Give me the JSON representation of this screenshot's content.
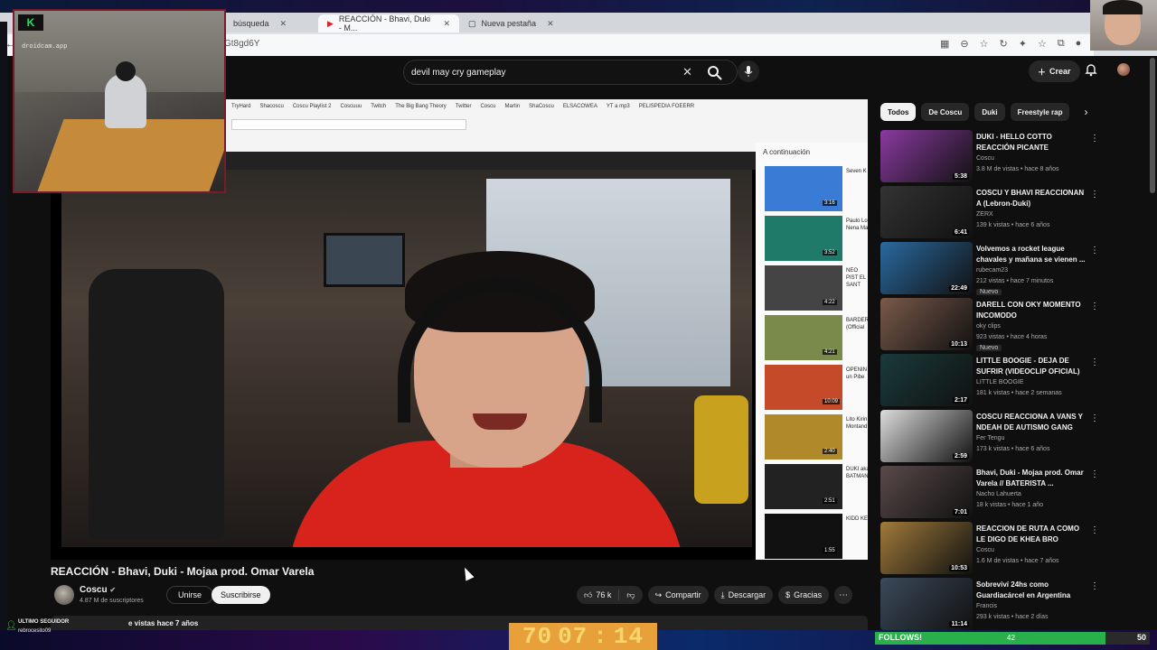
{
  "browser": {
    "tabs": [
      {
        "label": "búsqueda",
        "active": false
      },
      {
        "label": "REACCIÓN - Bhavi, Duki - M...",
        "active": true
      },
      {
        "label": "Nueva pestaña",
        "active": false
      }
    ],
    "url": "Gt8gd6Y"
  },
  "header": {
    "search_value": "devil may cry gameplay",
    "create_label": "Crear"
  },
  "player": {
    "inner_bookmarks": [
      "TryHard",
      "Shacoscu",
      "Coscu Playlist 2",
      "Coscuuu",
      "Twitch",
      "The Big Bang Theory",
      "Twitter",
      "Coscu",
      "Martin",
      "ShaCoscu",
      "ELSACOWEA",
      "YT a mp3",
      "PELISPEDIA FOEERR"
    ],
    "upnext_label": "A continuación",
    "upnext_items": [
      {
        "text": "Seven K",
        "duration": "3:16",
        "color": "#3a7bd5"
      },
      {
        "text": "Paulo Lo Nena Ma",
        "duration": "3:52",
        "color": "#1f7a6a"
      },
      {
        "text": "NEO PIST EL SANT",
        "duration": "4:22",
        "color": "#444"
      },
      {
        "text": "BARDER (Official",
        "duration": "4:21",
        "color": "#7a8a4a"
      },
      {
        "text": "OPENIN un Pibe",
        "duration": "10:09",
        "color": "#c44a2a"
      },
      {
        "text": "Lito Kirin Montand",
        "duration": "2:40",
        "color": "#b08a2a"
      },
      {
        "text": "DUKI aka BATMAN",
        "duration": "2:51",
        "color": "#222"
      },
      {
        "text": "KIDD KE",
        "duration": "1:55",
        "color": "#111"
      }
    ]
  },
  "video": {
    "title": "REACCIÓN - Bhavi, Duki - Mojaa prod. Omar Varela",
    "channel": "Coscu",
    "subscribers": "4.87 M de suscriptores",
    "join_label": "Unirse",
    "subscribe_label": "Suscribirse",
    "likes": "76 k",
    "share_label": "Compartir",
    "download_label": "Descargar",
    "thanks_label": "Gracias",
    "description_meta": "e vistas  hace 7 años"
  },
  "chips": [
    "Todos",
    "De Coscu",
    "Duki",
    "Freestyle rap"
  ],
  "related": [
    {
      "title": "DUKI - HELLO COTTO REACCIÓN PICANTE",
      "channel": "Coscu",
      "meta": "3.8 M de vistas • hace 8 años",
      "duration": "5:38",
      "badge": "",
      "color": "#8a3aa0"
    },
    {
      "title": "COSCU Y BHAVI REACCIONAN A (Lebron-Duki)",
      "channel": "ZERX",
      "meta": "139 k vistas • hace 6 años",
      "duration": "6:41",
      "badge": "",
      "color": "#333"
    },
    {
      "title": "Volvemos a rocket league chavales y mañana se vienen ...",
      "channel": "rubecam23",
      "meta": "212 vistas • hace 7 minutos",
      "duration": "22:49",
      "badge": "Nuevo",
      "color": "#2a6aa0"
    },
    {
      "title": "DARELL CON OKY MOMENTO INCOMODO",
      "channel": "oky clips",
      "meta": "923 vistas • hace 4 horas",
      "duration": "10:13",
      "badge": "Nuevo",
      "color": "#7a5a4a"
    },
    {
      "title": "LITTLE BOOGIE - DEJA DE SUFRIR (VIDEOCLIP OFICIAL)",
      "channel": "LITTLE BOOGIE",
      "meta": "181 k vistas • hace 2 semanas",
      "duration": "2:17",
      "badge": "",
      "color": "#1a3a3a"
    },
    {
      "title": "COSCU REACCIONA A VANS Y NDEAH DE AUTISMO GANG",
      "channel": "Fer Tengu",
      "meta": "173 k vistas • hace 6 años",
      "duration": "2:59",
      "badge": "",
      "color": "#dcdcdc"
    },
    {
      "title": "Bhavi, Duki - Mojaa prod. Omar Varela // BATERISTA ...",
      "channel": "Nacho Lahuerta",
      "meta": "18 k vistas • hace 1 año",
      "duration": "7:01",
      "badge": "",
      "color": "#5a4a4a"
    },
    {
      "title": "REACCION DE RUTA A COMO LE DIGO DE KHEA BRO",
      "channel": "Coscu",
      "meta": "1.6 M de vistas • hace 7 años",
      "duration": "10:53",
      "badge": "",
      "color": "#a07a3a"
    },
    {
      "title": "Sobreviví 24hs como Guardiacárcel en Argentina",
      "channel": "Francis",
      "meta": "293 k vistas • hace 2 días",
      "duration": "11:14",
      "badge": "",
      "color": "#3a4a5a"
    }
  ],
  "overlays": {
    "cam_logo": "K",
    "cam_text": "droidcam.app",
    "follower_label": "ULTIMO SEGUIDOR",
    "follower_name": "rebrocesito09",
    "timer": [
      "70",
      "07",
      ":",
      "14"
    ],
    "follows_label": "FOLLOWS!",
    "follows_current": "42",
    "follows_goal": "50",
    "follows_fraction": 0.84
  }
}
